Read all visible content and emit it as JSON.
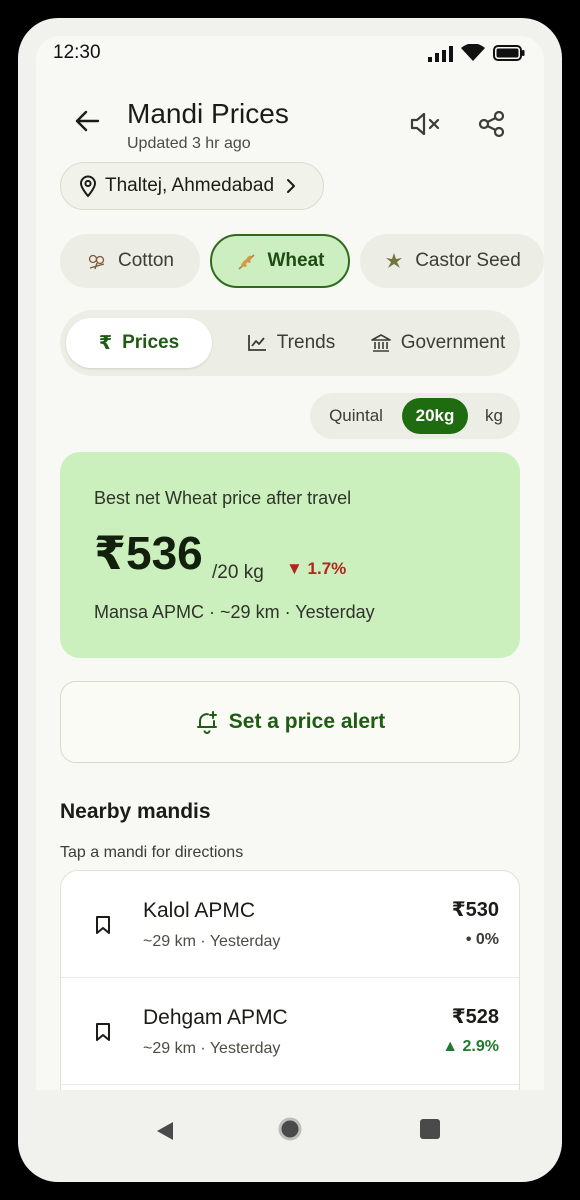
{
  "status_bar": {
    "time": "12:30"
  },
  "header": {
    "title": "Mandi Prices",
    "subtitle": "Updated 3 hr ago",
    "location": "Thaltej, Ahmedabad"
  },
  "crops": [
    {
      "label": "Cotton",
      "icon": "cotton-icon",
      "active": false
    },
    {
      "label": "Wheat",
      "icon": "wheat-icon",
      "active": true
    },
    {
      "label": "Castor Seed",
      "icon": "castor-seed-icon",
      "active": false
    }
  ],
  "tabs": [
    {
      "label": "Prices",
      "icon": "rupee-icon",
      "active": true
    },
    {
      "label": "Trends",
      "icon": "line-chart-icon",
      "active": false
    },
    {
      "label": "Government",
      "icon": "government-building-icon",
      "active": false
    }
  ],
  "units": {
    "options": [
      "Quintal",
      "20kg",
      "kg"
    ],
    "selected": "20kg"
  },
  "best_card": {
    "label": "Best net Wheat price after travel",
    "price": "₹536",
    "unit": "/20 kg",
    "change": "▼ 1.7%",
    "meta": "Mansa APMC · ~29 km · Yesterday"
  },
  "alert": {
    "label": "Set a price alert"
  },
  "nearby": {
    "title": "Nearby mandis",
    "subtitle": "Tap a mandi for directions",
    "items": [
      {
        "name": "Kalol APMC",
        "meta": "~29 km · Yesterday",
        "price": "₹530",
        "change": "• 0%",
        "trend": "flat"
      },
      {
        "name": "Dehgam APMC",
        "meta": "~29 km · Yesterday",
        "price": "₹528",
        "change": "▲ 2.9%",
        "trend": "up"
      }
    ]
  },
  "colors": {
    "accent": "#1f6b10",
    "card_bg": "#cbf0bd",
    "down": "#b3261e",
    "up": "#1f7a2e",
    "flat": "#3b3d36"
  }
}
